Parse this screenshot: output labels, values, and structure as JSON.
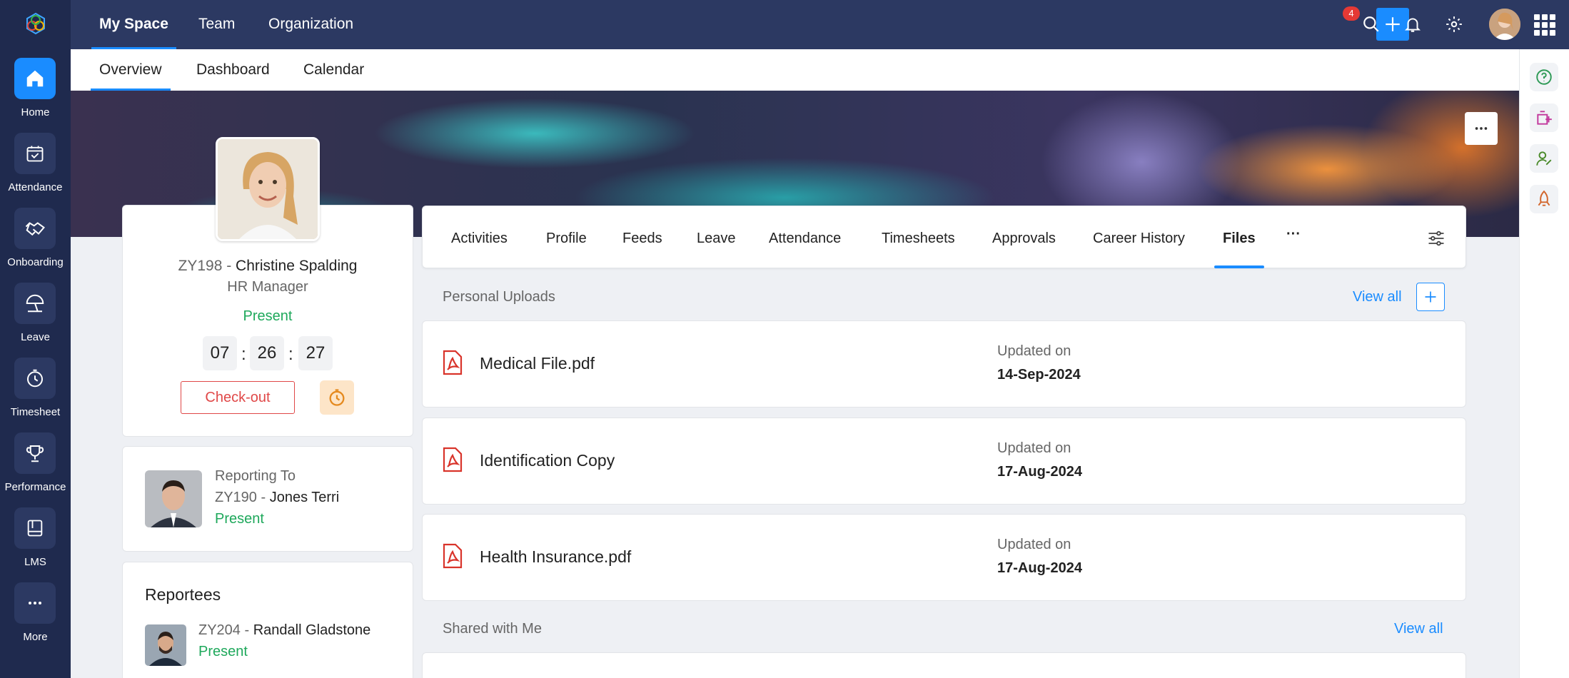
{
  "sidebar": {
    "items": [
      {
        "label": "Home",
        "icon": "home-icon"
      },
      {
        "label": "Attendance",
        "icon": "calendar-check-icon"
      },
      {
        "label": "Onboarding",
        "icon": "handshake-icon"
      },
      {
        "label": "Leave",
        "icon": "umbrella-icon"
      },
      {
        "label": "Timesheet",
        "icon": "stopwatch-icon"
      },
      {
        "label": "Performance",
        "icon": "trophy-icon"
      },
      {
        "label": "LMS",
        "icon": "book-icon"
      },
      {
        "label": "More",
        "icon": "more-icon"
      }
    ]
  },
  "topbar": {
    "tabs": [
      "My Space",
      "Team",
      "Organization"
    ],
    "notification_count": "4"
  },
  "subtabs": [
    "Overview",
    "Dashboard",
    "Calendar"
  ],
  "profile": {
    "id": "ZY198 - ",
    "name": "Christine Spalding",
    "role": "HR Manager",
    "status": "Present",
    "timer": {
      "hh": "07",
      "mm": "26",
      "ss": "27",
      "sep": ":"
    },
    "checkout_label": "Check-out"
  },
  "reporting": {
    "label": "Reporting To",
    "id": "ZY190 - ",
    "name": "Jones Terri",
    "status": "Present"
  },
  "reportees": {
    "title": "Reportees",
    "id": "ZY204 - ",
    "name": "Randall Gladstone",
    "status": "Present"
  },
  "profile_tabs": [
    "Activities",
    "Profile",
    "Feeds",
    "Leave",
    "Attendance",
    "Timesheets",
    "Approvals",
    "Career History",
    "Files",
    "···"
  ],
  "uploads": {
    "title": "Personal Uploads",
    "view_all": "View all",
    "files": [
      {
        "name": "Medical File.pdf",
        "updated_label": "Updated on",
        "date": "14-Sep-2024"
      },
      {
        "name": "Identification Copy",
        "updated_label": "Updated on",
        "date": "17-Aug-2024"
      },
      {
        "name": "Health Insurance.pdf",
        "updated_label": "Updated on",
        "date": "17-Aug-2024"
      }
    ]
  },
  "shared": {
    "title": "Shared with Me",
    "view_all": "View all"
  },
  "colors": {
    "sidebar": "#1f2a4e",
    "topbar": "#2c3962",
    "accent": "#1a8cff",
    "present": "#1ea85b",
    "checkout": "#e04848"
  }
}
